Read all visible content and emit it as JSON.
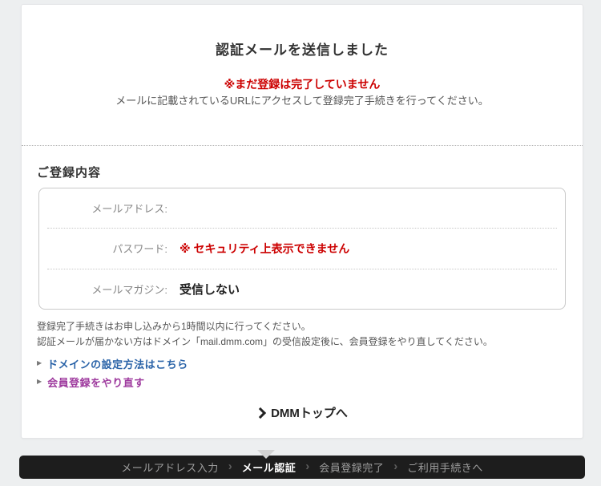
{
  "header": {
    "title": "認証メールを送信しました",
    "warning": "※まだ登録は完了していません",
    "instruction": "メールに記載されているURLにアクセスして登録完了手続きを行ってください。"
  },
  "registration": {
    "heading": "ご登録内容",
    "rows": [
      {
        "label": "メールアドレス:",
        "value": ""
      },
      {
        "label": "パスワード:",
        "value": "※ セキュリティ上表示できません"
      },
      {
        "label": "メールマガジン:",
        "value": "受信しない"
      }
    ]
  },
  "notes": {
    "line1": "登録完了手続きはお申し込みから1時間以内に行ってください。",
    "line2": "認証メールが届かない方はドメイン「mail.dmm.com」の受信設定後に、会員登録をやり直してください。"
  },
  "links": {
    "bullet": "▶",
    "items": [
      {
        "label": "ドメインの設定方法はこちら",
        "state": "normal"
      },
      {
        "label": "会員登録をやり直す",
        "state": "visited"
      }
    ]
  },
  "home_link": {
    "chevron": "❯",
    "label": "DMMトップへ"
  },
  "stepper": {
    "separator": "›",
    "active_step": "メール認証",
    "steps": [
      {
        "label": "メールアドレス入力"
      },
      {
        "label": "メール認証"
      },
      {
        "label": "会員登録完了"
      },
      {
        "label": "ご利用手続きへ"
      }
    ]
  },
  "colors": {
    "page_background": "#edeff0",
    "card_background": "#ffffff",
    "alert_red": "#cc0000",
    "link_blue": "#2a63a8",
    "link_visited_purple": "#9e3a9e",
    "bar_background": "#1d1d1d",
    "step_active": "#ffffff",
    "step_inactive": "#9d9d9d"
  }
}
